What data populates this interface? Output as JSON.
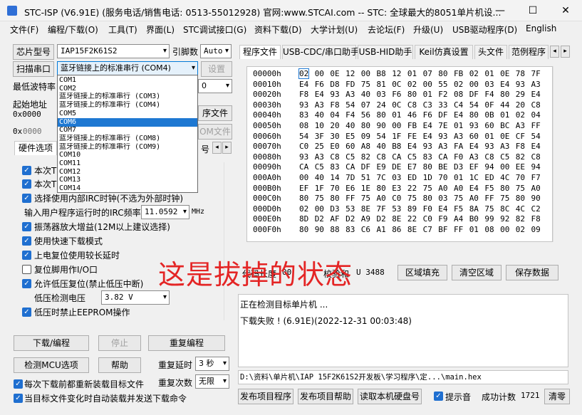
{
  "window": {
    "title": "STC-ISP (V6.91E) (服务电话/销售电话: 0513-55012928) 官网:www.STCAI.com  -- STC: 全球最大的8051单片机设...",
    "minimize": "—",
    "maximize": "☐",
    "close": "✕"
  },
  "menu": [
    "文件(F)",
    "编程/下载(O)",
    "工具(T)",
    "界面(L)",
    "STC调试接口(G)",
    "资料下载(D)",
    "大学计划(U)",
    "去论坛(F)",
    "升级(U)",
    "USB驱动程序(D)",
    "English"
  ],
  "left": {
    "chip_label": "芯片型号",
    "chip_value": "IAP15F2K61S2",
    "pins_label": "引脚数",
    "pins_value": "Auto",
    "scan_button": "扫描串口",
    "port_value": "蓝牙链接上的标准串行 (COM4)",
    "settings_button": "设置",
    "min_baud_label": "最低波特率",
    "start_addr_label": "起始地址",
    "start_addr_value": "0x0000",
    "open_prog_button": "序文件",
    "addr2_prefix": "0x",
    "addr2_value": "0000",
    "open_eeprom_button": "OM文件",
    "hw_tab": "硬件选项",
    "hw_tab_suffix": "号",
    "baud_tail": "0",
    "irc_label": "输入用户程序运行时的IRC频率",
    "irc_value": "11.0592",
    "irc_unit": "MHz",
    "lvd_label": "低压检测电压",
    "lvd_value": "3.82 V"
  },
  "options": [
    {
      "text": "本次T",
      "checked": true
    },
    {
      "text": "本次T",
      "checked": true
    },
    {
      "text": "选择使用内部IRC时钟(不选为外部时钟)",
      "checked": true
    },
    {
      "text": "振荡器放大增益(12M以上建议选择)",
      "checked": true
    },
    {
      "text": "使用快速下载模式",
      "checked": true
    },
    {
      "text": "上电复位使用较长延时",
      "checked": true
    },
    {
      "text": "复位脚用作I/O口",
      "checked": false
    },
    {
      "text": "允许低压复位(禁止低压中断)",
      "checked": true
    },
    {
      "text": "低压时禁止EEPROM操作",
      "checked": true
    }
  ],
  "ports": [
    "COM1",
    "COM2",
    "蓝牙链接上的标准串行 (COM3)",
    "蓝牙链接上的标准串行 (COM4)",
    "COM5",
    "COM6",
    "COM7",
    "蓝牙链接上的标准串行 (COM8)",
    "蓝牙链接上的标准串行 (COM9)",
    "COM10",
    "COM11",
    "COM12",
    "COM13",
    "COM14"
  ],
  "port_selected_index": 5,
  "buttons": {
    "download": "下载/编程",
    "stop": "停止",
    "reprogram": "重复编程",
    "detect_mcu": "检测MCU选项",
    "help": "帮助",
    "repeat_delay_label": "重复延时",
    "repeat_delay_value": "3 秒",
    "repeat_count_label": "重复次数",
    "repeat_count_value": "无限",
    "reload_each": "每次下载前都重新装载目标文件",
    "auto_reload": "当目标文件变化时自动装载并发送下载命令"
  },
  "right": {
    "tabs": [
      "程序文件",
      "USB-CDC/串口助手",
      "USB-HID助手",
      "Keil仿真设置",
      "头文件",
      "范例程序"
    ],
    "hex_rows": [
      {
        "addr": "00000h",
        "bytes": [
          "02",
          "00",
          "0E",
          "12",
          "00",
          "B8",
          "12",
          "01",
          "07",
          "80",
          "FB",
          "02",
          "01",
          "0E",
          "78",
          "7F"
        ]
      },
      {
        "addr": "00010h",
        "bytes": [
          "E4",
          "F6",
          "D8",
          "FD",
          "75",
          "81",
          "0C",
          "02",
          "00",
          "55",
          "02",
          "00",
          "03",
          "E4",
          "93",
          "A3"
        ]
      },
      {
        "addr": "00020h",
        "bytes": [
          "F8",
          "E4",
          "93",
          "A3",
          "40",
          "03",
          "F6",
          "80",
          "01",
          "F2",
          "08",
          "DF",
          "F4",
          "80",
          "29",
          "E4"
        ]
      },
      {
        "addr": "00030h",
        "bytes": [
          "93",
          "A3",
          "F8",
          "54",
          "07",
          "24",
          "0C",
          "C8",
          "C3",
          "33",
          "C4",
          "54",
          "0F",
          "44",
          "20",
          "C8"
        ]
      },
      {
        "addr": "00040h",
        "bytes": [
          "83",
          "40",
          "04",
          "F4",
          "56",
          "80",
          "01",
          "46",
          "F6",
          "DF",
          "E4",
          "80",
          "0B",
          "01",
          "02",
          "04"
        ]
      },
      {
        "addr": "00050h",
        "bytes": [
          "08",
          "10",
          "20",
          "40",
          "80",
          "90",
          "00",
          "FB",
          "E4",
          "7E",
          "01",
          "93",
          "60",
          "BC",
          "A3",
          "FF"
        ]
      },
      {
        "addr": "00060h",
        "bytes": [
          "54",
          "3F",
          "30",
          "E5",
          "09",
          "54",
          "1F",
          "FE",
          "E4",
          "93",
          "A3",
          "60",
          "01",
          "0E",
          "CF",
          "54"
        ]
      },
      {
        "addr": "00070h",
        "bytes": [
          "C0",
          "25",
          "E0",
          "60",
          "A8",
          "40",
          "B8",
          "E4",
          "93",
          "A3",
          "FA",
          "E4",
          "93",
          "A3",
          "F8",
          "E4"
        ]
      },
      {
        "addr": "00080h",
        "bytes": [
          "93",
          "A3",
          "C8",
          "C5",
          "82",
          "C8",
          "CA",
          "C5",
          "83",
          "CA",
          "F0",
          "A3",
          "C8",
          "C5",
          "82",
          "C8"
        ]
      },
      {
        "addr": "00090h",
        "bytes": [
          "CA",
          "C5",
          "83",
          "CA",
          "DF",
          "E9",
          "DE",
          "E7",
          "80",
          "BE",
          "D3",
          "EF",
          "94",
          "00",
          "EE",
          "94"
        ]
      },
      {
        "addr": "000A0h",
        "bytes": [
          "00",
          "40",
          "14",
          "7D",
          "51",
          "7C",
          "03",
          "ED",
          "1D",
          "70",
          "01",
          "1C",
          "ED",
          "4C",
          "70",
          "F7"
        ]
      },
      {
        "addr": "000B0h",
        "bytes": [
          "EF",
          "1F",
          "70",
          "E6",
          "1E",
          "80",
          "E3",
          "22",
          "75",
          "A0",
          "A0",
          "E4",
          "F5",
          "80",
          "75",
          "A0"
        ]
      },
      {
        "addr": "000C0h",
        "bytes": [
          "80",
          "75",
          "80",
          "FF",
          "75",
          "A0",
          "C0",
          "75",
          "80",
          "03",
          "75",
          "A0",
          "FF",
          "75",
          "80",
          "90"
        ]
      },
      {
        "addr": "000D0h",
        "bytes": [
          "02",
          "00",
          "D3",
          "53",
          "8E",
          "7F",
          "53",
          "89",
          "F0",
          "E4",
          "F5",
          "8A",
          "75",
          "8C",
          "4C",
          "C2"
        ]
      },
      {
        "addr": "000E0h",
        "bytes": [
          "8D",
          "D2",
          "AF",
          "D2",
          "A9",
          "D2",
          "8E",
          "22",
          "C0",
          "F9",
          "A4",
          "B0",
          "99",
          "92",
          "82",
          "F8"
        ]
      },
      {
        "addr": "000F0h",
        "bytes": [
          "80",
          "90",
          "88",
          "83",
          "C6",
          "A1",
          "86",
          "8E",
          "C7",
          "BF",
          "FF",
          "01",
          "08",
          "00",
          "02",
          "09"
        ]
      }
    ],
    "checksum_label": "代码长度",
    "checksum_value": "00",
    "checksum2_label": "校验和",
    "checksum2_value": "U 3488",
    "fill_button": "区域填充",
    "clear_button": "清空区域",
    "save_button": "保存数据",
    "status_lines": [
      "正在检测目标单片机 ...",
      "下载失败 ! (6.91E)(2022-12-31 00:03:48)"
    ],
    "path": "D:\\资料\\单片机\\IAP 15F2K61S2开发板\\学习程序\\定...\\main.hex",
    "publish_button": "发布项目程序",
    "publish_help_button": "发布项目帮助",
    "read_disk_button": "读取本机硬盘号",
    "beep_label": "提示音",
    "success_label": "成功计数",
    "success_count": "1721",
    "clear_count_button": "清零"
  },
  "overlay": "这是拔掉的状态"
}
